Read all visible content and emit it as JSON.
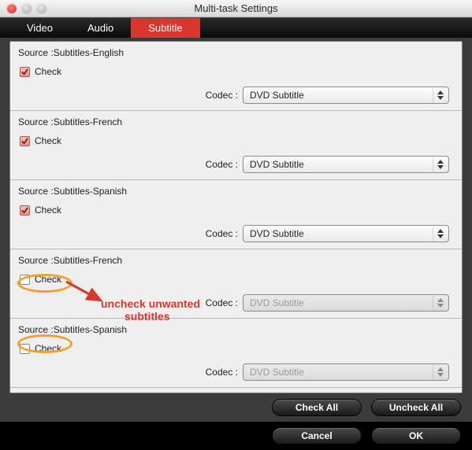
{
  "window": {
    "title": "Multi-task Settings"
  },
  "tabs": {
    "video": "Video",
    "audio": "Audio",
    "subtitle": "Subtitle"
  },
  "labels": {
    "codec": "Codec :",
    "check": "Check"
  },
  "rows": [
    {
      "source": "Source :Subtitles-English",
      "checked": true,
      "codec": "DVD Subtitle",
      "enabled": true
    },
    {
      "source": "Source :Subtitles-French",
      "checked": true,
      "codec": "DVD Subtitle",
      "enabled": true
    },
    {
      "source": "Source :Subtitles-Spanish",
      "checked": true,
      "codec": "DVD Subtitle",
      "enabled": true
    },
    {
      "source": "Source :Subtitles-French",
      "checked": false,
      "codec": "DVD Subtitle",
      "enabled": false
    },
    {
      "source": "Source :Subtitles-Spanish",
      "checked": false,
      "codec": "DVD Subtitle",
      "enabled": false
    }
  ],
  "annotation": {
    "line1": "uncheck unwanted",
    "line2": "subtitles"
  },
  "buttons": {
    "check_all": "Check All",
    "uncheck_all": "Uncheck All",
    "cancel": "Cancel",
    "ok": "OK"
  }
}
